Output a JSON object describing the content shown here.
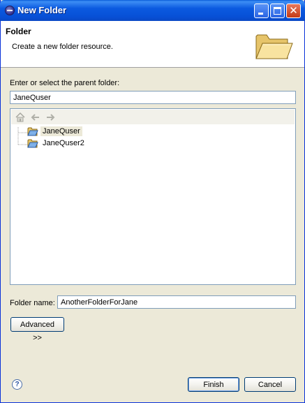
{
  "window": {
    "title": "New Folder"
  },
  "banner": {
    "title": "Folder",
    "description": "Create a new folder resource."
  },
  "parent_folder": {
    "label": "Enter or select the parent folder:",
    "value": "JaneQuser"
  },
  "tree": {
    "items": [
      {
        "label": "JaneQuser",
        "selected": true
      },
      {
        "label": "JaneQuser2",
        "selected": false
      }
    ]
  },
  "folder_name": {
    "label": "Folder name:",
    "value": "AnotherFolderForJane"
  },
  "buttons": {
    "advanced": "Advanced >>",
    "finish": "Finish",
    "cancel": "Cancel",
    "help": "?"
  },
  "icons": {
    "titlebar": "eclipse-icon",
    "banner": "open-folder-icon",
    "toolbar": [
      "home-icon",
      "back-icon",
      "forward-icon"
    ],
    "help": "help-icon"
  },
  "colors": {
    "titlebar": "#0b5ae0",
    "dialog_background": "#ece9d8",
    "field_border": "#7f9db9"
  }
}
